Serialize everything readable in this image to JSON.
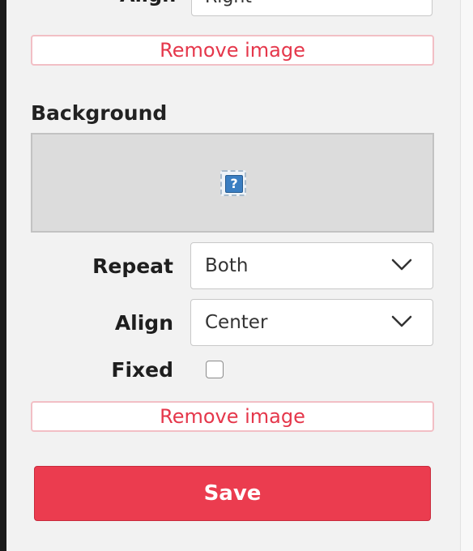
{
  "image_section": {
    "align_label": "Align",
    "align_value": "Right",
    "remove_label": "Remove image"
  },
  "background_section": {
    "title": "Background",
    "preview_icon": "broken-image-icon",
    "repeat_label": "Repeat",
    "repeat_value": "Both",
    "align_label": "Align",
    "align_value": "Center",
    "fixed_label": "Fixed",
    "fixed_checked": false,
    "remove_label": "Remove image"
  },
  "save_label": "Save",
  "colors": {
    "accent": "#eb3c4f",
    "remove_text": "#e5374b",
    "remove_border": "#f2bfc5",
    "panel_bg": "#f2f2f2"
  }
}
